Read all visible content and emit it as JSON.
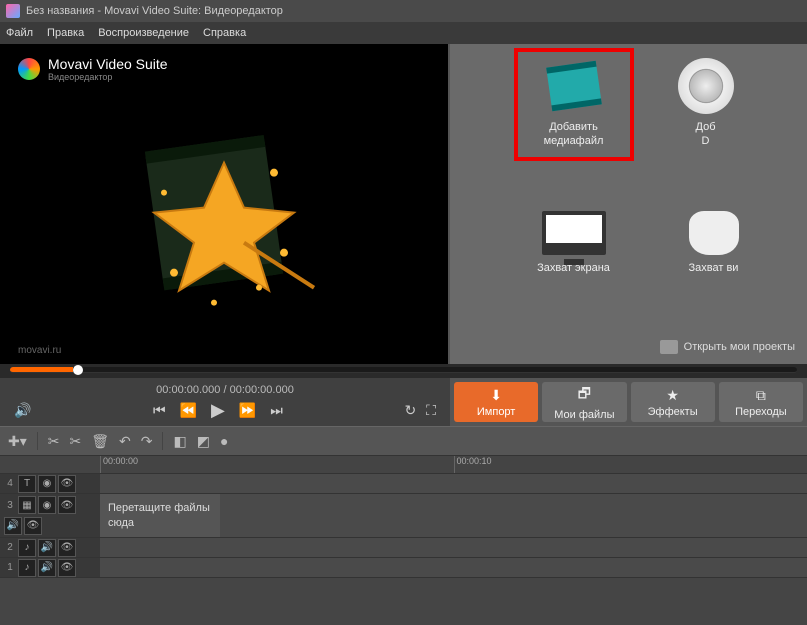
{
  "titlebar": {
    "text": "Без названия - Movavi Video Suite: Видеоредактор"
  },
  "menubar": [
    "Файл",
    "Правка",
    "Воспроизведение",
    "Справка"
  ],
  "preview": {
    "brand": "Movavi Video Suite",
    "subtitle": "Видеоредактор",
    "url": "movavi.ru"
  },
  "import_panel": {
    "items": [
      {
        "id": "add-media",
        "label": "Добавить медиафайл",
        "highlight": true
      },
      {
        "id": "add-dvd",
        "label": "Доб\nD"
      },
      {
        "id": "screen-capture",
        "label": "Захват экрана"
      },
      {
        "id": "webcam-capture",
        "label": "Захват ви"
      }
    ],
    "open_projects": "Открыть мои проекты"
  },
  "playback": {
    "time_current": "00:00:00.000",
    "time_total": "00:00:00.000"
  },
  "tabs": [
    {
      "id": "import",
      "label": "Импорт",
      "active": true
    },
    {
      "id": "my-files",
      "label": "Мои файлы"
    },
    {
      "id": "effects",
      "label": "Эффекты"
    },
    {
      "id": "transitions",
      "label": "Переходы"
    }
  ],
  "timeline": {
    "ruler": [
      "00:00:00",
      "00:00:10"
    ],
    "tracks": [
      {
        "num": "4",
        "icons": [
          "T",
          "◉",
          "👁"
        ]
      },
      {
        "num": "3",
        "icons": [
          "▦",
          "◉",
          "👁",
          "🔊",
          "👁"
        ]
      },
      {
        "num": "2",
        "icons": [
          "♪",
          "🔊",
          "👁"
        ]
      },
      {
        "num": "1",
        "icons": [
          "♪",
          "🔊",
          "👁"
        ]
      }
    ],
    "drop_hint": "Перетащите файлы сюда"
  }
}
